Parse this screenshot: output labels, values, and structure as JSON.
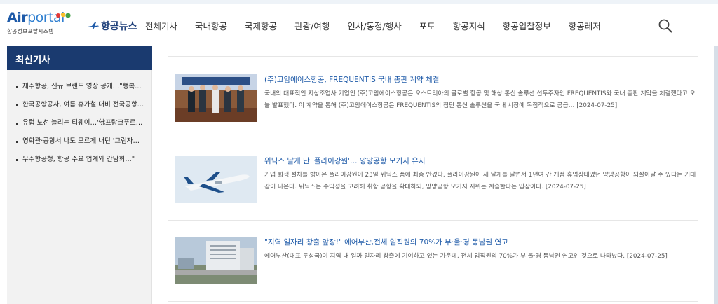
{
  "logo": {
    "title_air": "Air",
    "title_portal": "portal",
    "subtitle": "항공정보포탈시스템"
  },
  "nav": {
    "home_label": "항공뉴스",
    "items": [
      "전체기사",
      "국내항공",
      "국제항공",
      "관광/여행",
      "인사/동정/행사",
      "포토",
      "항공지식",
      "항공입찰정보",
      "항공레저"
    ]
  },
  "sidebar": {
    "title": "최신기사",
    "items": [
      "제주항공, 신규 브랜드 영상 공개…\"행복…",
      "한국공항공사, 여름 휴가철 대비 전국공항…",
      "유럽 노선 늘리는 티웨이…'佛프랑크푸르…",
      "영화관·공항서 나도 모르게 내던 '그림자…",
      "우주항공청, 항공 주요 업계와 간담회…\""
    ]
  },
  "articles": [
    {
      "title": "(주)고암에이스항공, FREQUENTIS 국내 총판 계약 체결",
      "body": "국내의 대표적인 지상조업사 기업인 (주)고암에이스항공은 오스트리아의 글로벌 항공 및 해상 통신 솔루션 선두주자인 FREQUENTIS와 국내 총판 계약을 체결했다고 오늘 발표했다. 이 계약을 통해 (주)고암에이스항공은 FREQUENTIS의 첨단 통신 솔루션을 국내 시장에 독점적으로 공급…",
      "date": "[2024-07-25]"
    },
    {
      "title": "위닉스 날개 단 '플라이강원'… 양양공항 모기지 유지",
      "body": "기업 회생 절차를 밟아온 플라이강원이 23일 위닉스 품에 최종 안겼다. 플라이강원이 새 날개를 달면서 1년여 간 개점 휴업상태였던 양양공항이 되살아날 수 있다는 기대감이 나온다. 위닉스는 수익성을 고려해 취항 공항을 확대하되, 양양공항 모기지 지위는 계승한다는 입장이다.",
      "date": "[2024-07-25]"
    },
    {
      "title": "\"지역 일자리 창출 앞장!\" 에어부산,전체 임직원의 70%가 부·울·경 동남권 연고",
      "body": "에어부산(대표 두성국)이 지역 내 일짜 일자리 창출에 기여하고 있는 가운데, 전체 임직원의 70%가 부·울·경 동남권 연고인 것으로 나타났다.",
      "date": "[2024-07-25]"
    }
  ],
  "colors": {
    "brand_navy": "#1a3a6f",
    "link_blue": "#1e5aa8"
  },
  "icons": {
    "search": "search-icon",
    "plane": "plane-icon"
  }
}
